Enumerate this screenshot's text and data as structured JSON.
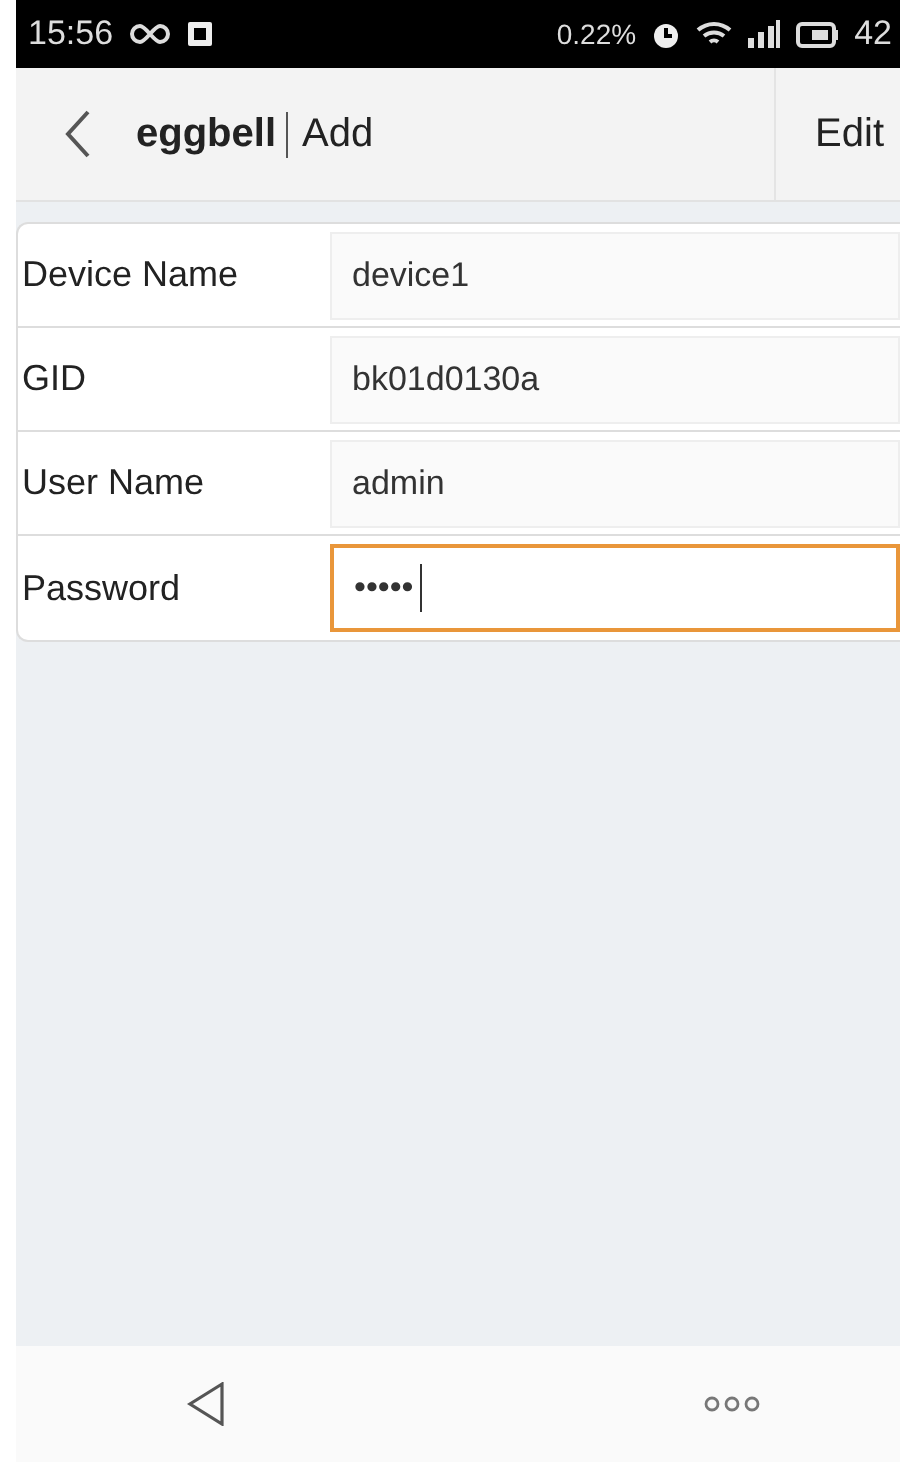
{
  "status_bar": {
    "time": "15:56",
    "data_rate": "0.22%",
    "battery": "42"
  },
  "nav_bar": {
    "back_label": "eggbell",
    "title": "Add",
    "action": "Edit"
  },
  "form": [
    {
      "label": "Device Name",
      "value": "device1",
      "focused": false
    },
    {
      "label": "GID",
      "value": "bk01d0130a",
      "focused": false
    },
    {
      "label": "User Name",
      "value": "admin",
      "focused": false
    },
    {
      "label": "Password",
      "value": "•••••",
      "focused": true
    }
  ]
}
